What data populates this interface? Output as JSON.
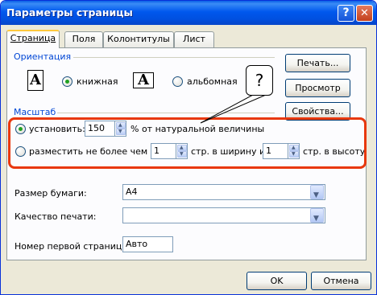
{
  "window": {
    "title": "Параметры страницы",
    "help": "?",
    "close": "✕"
  },
  "tabs": [
    "Страница",
    "Поля",
    "Колонтитулы",
    "Лист"
  ],
  "orientation": {
    "label": "Ориентация",
    "portrait_icon": "A",
    "portrait": "книжная",
    "landscape_icon": "A",
    "landscape": "альбомная",
    "selected": "portrait"
  },
  "scale": {
    "label": "Масштаб",
    "set_label": "установить:",
    "set_value": "150",
    "set_suffix": "% от натуральной величины",
    "fit_label": "разместить не более чем на:",
    "fit_wide": "1",
    "fit_wide_suffix": "стр. в ширину и",
    "fit_tall": "1",
    "fit_tall_suffix": "стр. в высоту",
    "selected": "set"
  },
  "paper_size": {
    "label": "Размер бумаги:",
    "value": "A4"
  },
  "print_quality": {
    "label": "Качество печати:",
    "value": ""
  },
  "first_page": {
    "label": "Номер первой страницы:",
    "value": "Авто"
  },
  "side_buttons": {
    "print": "Печать...",
    "preview": "Просмотр",
    "properties": "Свойства..."
  },
  "footer": {
    "ok": "OK",
    "cancel": "Отмена"
  },
  "callout": "?",
  "colors": {
    "accent": "#0046d5",
    "highlight": "#e8380d",
    "titlebar": "#0058ee"
  }
}
